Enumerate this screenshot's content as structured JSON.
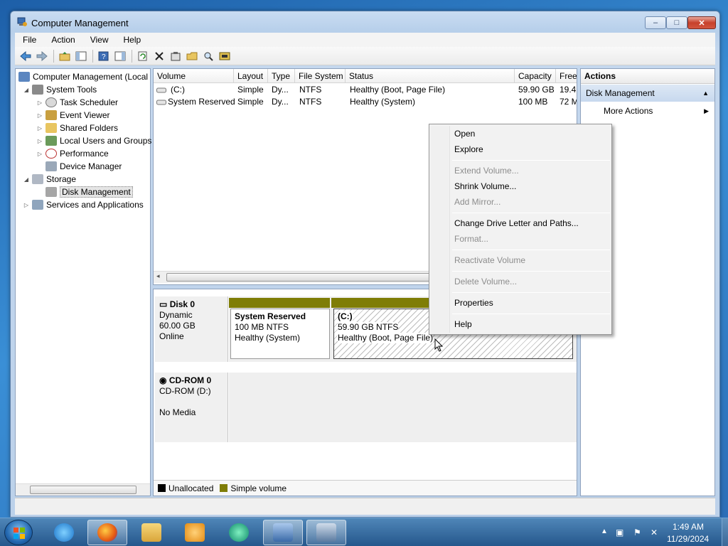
{
  "window": {
    "title": "Computer Management",
    "min": "–",
    "max": "□",
    "close": "✕"
  },
  "menu": [
    "File",
    "Action",
    "View",
    "Help"
  ],
  "tree": [
    {
      "label": "Computer Management (Local",
      "exp": ""
    },
    {
      "label": "System Tools",
      "exp": "◢"
    },
    {
      "label": "Task Scheduler",
      "exp": "▷"
    },
    {
      "label": "Event Viewer",
      "exp": "▷"
    },
    {
      "label": "Shared Folders",
      "exp": "▷"
    },
    {
      "label": "Local Users and Groups",
      "exp": "▷"
    },
    {
      "label": "Performance",
      "exp": "▷"
    },
    {
      "label": "Device Manager",
      "exp": ""
    },
    {
      "label": "Storage",
      "exp": "◢"
    },
    {
      "label": "Disk Management",
      "exp": ""
    },
    {
      "label": "Services and Applications",
      "exp": "▷"
    }
  ],
  "list": {
    "columns": [
      "Volume",
      "Layout",
      "Type",
      "File System",
      "Status",
      "Capacity",
      "Free"
    ],
    "rows": [
      {
        "volume": "(C:)",
        "layout": "Simple",
        "type": "Dy...",
        "fs": "NTFS",
        "status": "Healthy (Boot, Page File)",
        "capacity": "59.90 GB",
        "free": "19.4"
      },
      {
        "volume": "System Reserved",
        "layout": "Simple",
        "type": "Dy...",
        "fs": "NTFS",
        "status": "Healthy (System)",
        "capacity": "100 MB",
        "free": "72 M"
      }
    ]
  },
  "disks": [
    {
      "name": "Disk 0",
      "type": "Dynamic",
      "size": "60.00 GB",
      "state": "Online"
    },
    {
      "name": "CD-ROM 0",
      "type": "CD-ROM (D:)",
      "size": "",
      "state": "No Media"
    }
  ],
  "partitions": [
    {
      "name": "System Reserved",
      "size": "100 MB NTFS",
      "status": "Healthy (System)"
    },
    {
      "name": "(C:)",
      "size": "59.90 GB NTFS",
      "status": "Healthy (Boot, Page File)"
    }
  ],
  "legend": {
    "unallocated": "Unallocated",
    "simple": "Simple volume"
  },
  "actions": {
    "title": "Actions",
    "section": "Disk Management",
    "more": "More Actions"
  },
  "context_menu": [
    {
      "label": "Open",
      "enabled": true
    },
    {
      "label": "Explore",
      "enabled": true
    },
    {
      "label": "Extend Volume...",
      "enabled": false
    },
    {
      "label": "Shrink Volume...",
      "enabled": true
    },
    {
      "label": "Add Mirror...",
      "enabled": false
    },
    {
      "label": "Change Drive Letter and Paths...",
      "enabled": true
    },
    {
      "label": "Format...",
      "enabled": false
    },
    {
      "label": "Reactivate Volume",
      "enabled": false
    },
    {
      "label": "Delete Volume...",
      "enabled": false
    },
    {
      "label": "Properties",
      "enabled": true
    },
    {
      "label": "Help",
      "enabled": true
    }
  ],
  "taskbar": {
    "time": "1:49 AM",
    "date": "11/29/2024"
  },
  "colors": {
    "simple_volume": "#7f7d06",
    "unallocated": "#000000",
    "accent": "#2b6cb5"
  }
}
